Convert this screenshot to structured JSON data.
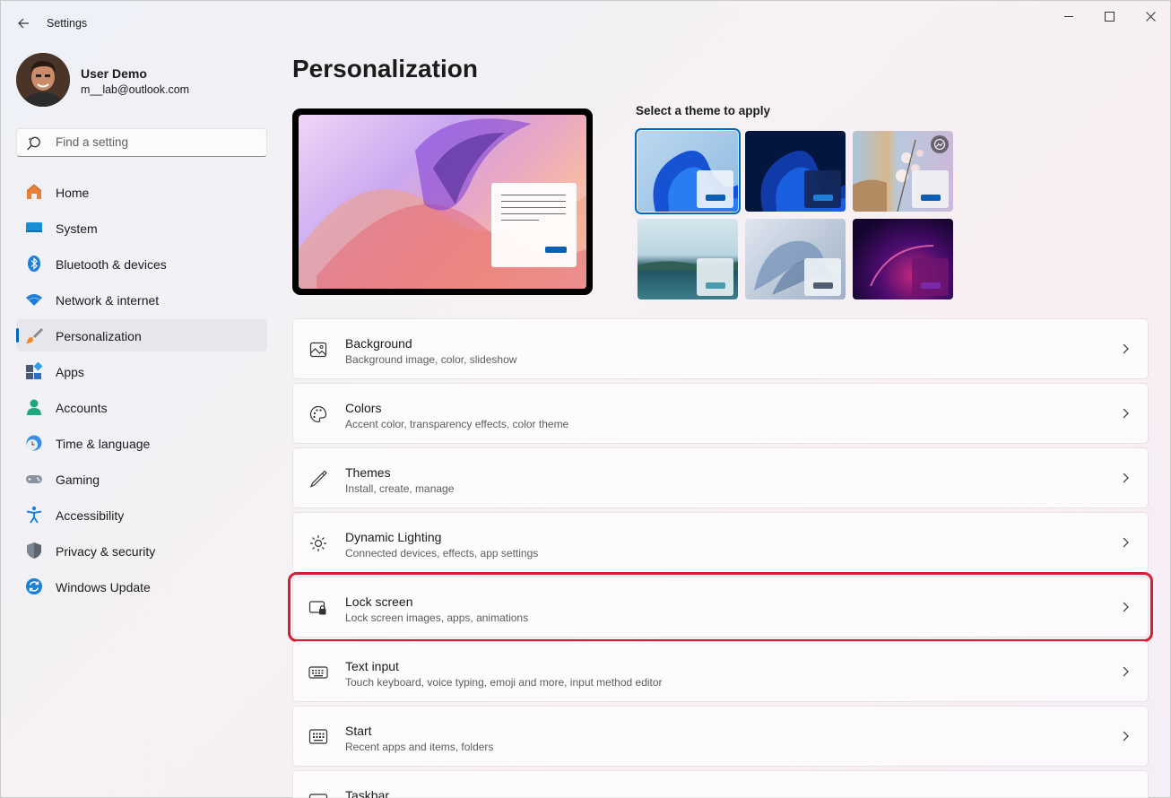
{
  "window": {
    "title": "Settings",
    "controls": [
      "minimize",
      "maximize",
      "close"
    ]
  },
  "profile": {
    "name": "User Demo",
    "email": "m__lab@outlook.com"
  },
  "search": {
    "placeholder": "Find a setting"
  },
  "sidebar": {
    "items": [
      {
        "label": "Home",
        "icon": "home-icon",
        "active": false
      },
      {
        "label": "System",
        "icon": "system-icon",
        "active": false
      },
      {
        "label": "Bluetooth & devices",
        "icon": "bluetooth-icon",
        "active": false
      },
      {
        "label": "Network & internet",
        "icon": "wifi-icon",
        "active": false
      },
      {
        "label": "Personalization",
        "icon": "brush-icon",
        "active": true
      },
      {
        "label": "Apps",
        "icon": "apps-icon",
        "active": false
      },
      {
        "label": "Accounts",
        "icon": "accounts-icon",
        "active": false
      },
      {
        "label": "Time & language",
        "icon": "time-language-icon",
        "active": false
      },
      {
        "label": "Gaming",
        "icon": "gamepad-icon",
        "active": false
      },
      {
        "label": "Accessibility",
        "icon": "accessibility-icon",
        "active": false
      },
      {
        "label": "Privacy & security",
        "icon": "shield-icon",
        "active": false
      },
      {
        "label": "Windows Update",
        "icon": "update-icon",
        "active": false
      }
    ]
  },
  "main": {
    "title": "Personalization",
    "themes": {
      "label": "Select a theme to apply",
      "selected_index": 0
    },
    "settings": [
      {
        "title": "Background",
        "desc": "Background image, color, slideshow",
        "icon": "image-icon"
      },
      {
        "title": "Colors",
        "desc": "Accent color, transparency effects, color theme",
        "icon": "palette-icon"
      },
      {
        "title": "Themes",
        "desc": "Install, create, manage",
        "icon": "pen-icon"
      },
      {
        "title": "Dynamic Lighting",
        "desc": "Connected devices, effects, app settings",
        "icon": "lighting-icon"
      },
      {
        "title": "Lock screen",
        "desc": "Lock screen images, apps, animations",
        "icon": "lock-screen-icon",
        "highlighted": true
      },
      {
        "title": "Text input",
        "desc": "Touch keyboard, voice typing, emoji and more, input method editor",
        "icon": "keyboard-icon"
      },
      {
        "title": "Start",
        "desc": "Recent apps and items, folders",
        "icon": "start-icon"
      },
      {
        "title": "Taskbar",
        "desc": "",
        "icon": "taskbar-icon"
      }
    ]
  },
  "colors": {
    "accent": "#0067c0",
    "highlight_box": "#d21f33"
  }
}
